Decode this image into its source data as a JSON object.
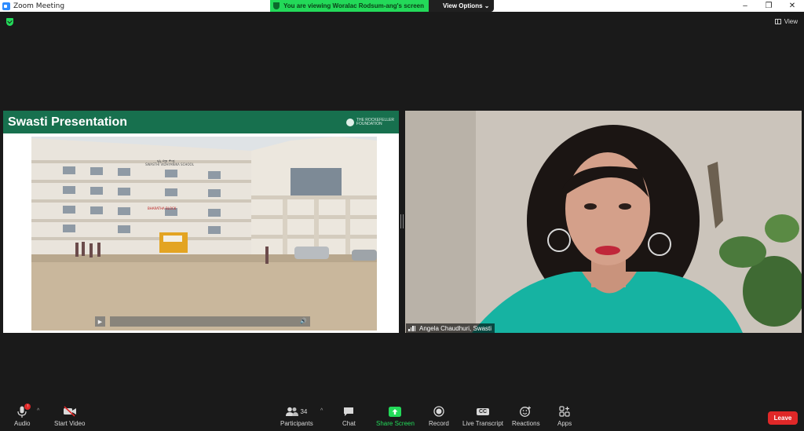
{
  "window": {
    "title": "Zoom Meeting",
    "controls": {
      "minimize": "–",
      "restore": "❐",
      "close": "✕"
    }
  },
  "share_banner": {
    "text": "You are viewing Woralac Rodsum-ang's screen",
    "view_options": "View Options ⌄",
    "color": "#23d959"
  },
  "top_right": {
    "view_label": "View"
  },
  "shared_slide": {
    "title": "Swasti Presentation",
    "logo_text_line1": "THE ROCKEFELLER",
    "logo_text_line2": "FOUNDATION",
    "header_color": "#17704e",
    "photo_sign_1": "ಸ್ವಸ್ತಿ ವಿದ್ಯಾ ಕೇಂದ್ರ",
    "photo_sign_2": "SWASTHI VIDHYANIKA SCHOOL",
    "photo_sign_3": "BHARATHA BLOCK",
    "video_play": "▶",
    "video_volume": "🔊"
  },
  "participant_video": {
    "name": "Angela Chaudhuri, Swasti"
  },
  "toolbar": {
    "audio": {
      "label": "Audio",
      "badge": "!"
    },
    "start_video": {
      "label": "Start Video"
    },
    "participants": {
      "label": "Participants",
      "count": "34"
    },
    "chat": {
      "label": "Chat"
    },
    "share_screen": {
      "label": "Share Screen"
    },
    "record": {
      "label": "Record"
    },
    "live_transcript": {
      "label": "Live Transcript",
      "icon_text": "CC"
    },
    "reactions": {
      "label": "Reactions"
    },
    "apps": {
      "label": "Apps"
    },
    "leave": {
      "label": "Leave",
      "color": "#e02828"
    }
  }
}
